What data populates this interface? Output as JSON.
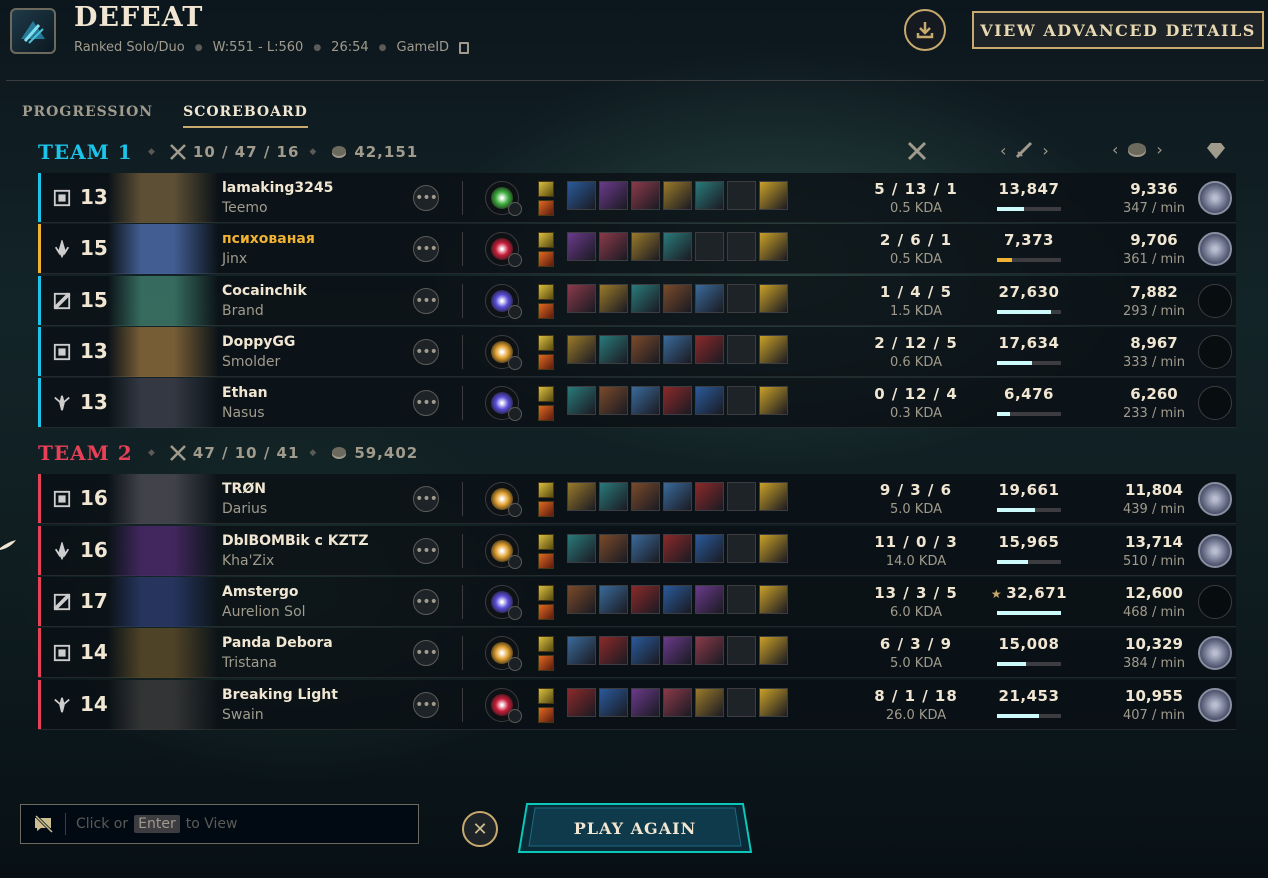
{
  "header": {
    "title": "DEFEAT",
    "queue": "Ranked Solo/Duo",
    "record": "W:551 - L:560",
    "duration": "26:54",
    "game_id_label": "GameID",
    "advanced_button": "VIEW ADVANCED DETAILS",
    "download_icon": "download-icon"
  },
  "tabs": [
    {
      "label": "PROGRESSION",
      "active": false
    },
    {
      "label": "SCOREBOARD",
      "active": true
    }
  ],
  "columns": {
    "kda_icon": "crossed-swords-icon",
    "damage_icon": "sword-icon",
    "gold_icon": "gold-coins-icon",
    "rank_icon": "diamond-icon"
  },
  "teams": [
    {
      "name": "TEAM 1",
      "color": "#1bc4e8",
      "kda": "10 / 47 / 16",
      "gold": "42,151",
      "players": [
        {
          "level": "13",
          "role": "top",
          "name": "lamaking3245",
          "champion": "Teemo",
          "kda": "5 / 13 / 1",
          "kda_ratio": "0.5 KDA",
          "damage": "13,847",
          "damage_fraction": 0.42,
          "gold": "9,336",
          "gold_per_min": "347 / min",
          "portrait_color": "#6b5a3a",
          "keystone_color": "#3fae3f",
          "emblem": true,
          "self": false
        },
        {
          "level": "15",
          "role": "bottom",
          "name": "психованая",
          "champion": "Jinx",
          "kda": "2 / 6 / 1",
          "kda_ratio": "0.5 KDA",
          "damage": "7,373",
          "damage_fraction": 0.23,
          "gold": "9,706",
          "gold_per_min": "361 / min",
          "portrait_color": "#4b6aa8",
          "keystone_color": "#c9203c",
          "emblem": true,
          "self": true
        },
        {
          "level": "15",
          "role": "support",
          "name": "Cocainchik",
          "champion": "Brand",
          "kda": "1 / 4 / 5",
          "kda_ratio": "1.5 KDA",
          "damage": "27,630",
          "damage_fraction": 0.85,
          "gold": "7,882",
          "gold_per_min": "293 / min",
          "portrait_color": "#3d7a6a",
          "keystone_color": "#5b4fd8",
          "emblem": false,
          "self": false
        },
        {
          "level": "13",
          "role": "top",
          "name": "DoppyGG",
          "champion": "Smolder",
          "kda": "2 / 12 / 5",
          "kda_ratio": "0.6 KDA",
          "damage": "17,634",
          "damage_fraction": 0.54,
          "gold": "8,967",
          "gold_per_min": "333 / min",
          "portrait_color": "#8a6a3a",
          "keystone_color": "#e0a030",
          "emblem": false,
          "self": false
        },
        {
          "level": "13",
          "role": "jungle",
          "name": "Ethan",
          "champion": "Nasus",
          "kda": "0 / 12 / 4",
          "kda_ratio": "0.3 KDA",
          "damage": "6,476",
          "damage_fraction": 0.2,
          "gold": "6,260",
          "gold_per_min": "233 / min",
          "portrait_color": "#3a3f4a",
          "keystone_color": "#5b4fd8",
          "emblem": false,
          "self": false
        }
      ]
    },
    {
      "name": "TEAM 2",
      "color": "#e84057",
      "kda": "47 / 10 / 41",
      "gold": "59,402",
      "players": [
        {
          "level": "16",
          "role": "top",
          "name": "TRØN",
          "champion": "Darius",
          "kda": "9 / 3 / 6",
          "kda_ratio": "5.0 KDA",
          "damage": "19,661",
          "damage_fraction": 0.6,
          "gold": "11,804",
          "gold_per_min": "439 / min",
          "portrait_color": "#4a4a52",
          "keystone_color": "#e0a030",
          "emblem": true,
          "self": false
        },
        {
          "level": "16",
          "role": "bottom",
          "name": "DblBOMBik с KZTZ",
          "champion": "Kha'Zix",
          "kda": "11 / 0 / 3",
          "kda_ratio": "14.0 KDA",
          "damage": "15,965",
          "damage_fraction": 0.49,
          "gold": "13,714",
          "gold_per_min": "510 / min",
          "portrait_color": "#4a2a6a",
          "keystone_color": "#e0a030",
          "emblem": true,
          "self": false
        },
        {
          "level": "17",
          "role": "support",
          "name": "Amstergo",
          "champion": "Aurelion Sol",
          "kda": "13 / 3 / 5",
          "kda_ratio": "6.0 KDA",
          "damage": "32,671",
          "damage_fraction": 1.0,
          "damage_star": "★",
          "gold": "12,600",
          "gold_per_min": "468 / min",
          "portrait_color": "#2a3a6a",
          "keystone_color": "#5b4fd8",
          "emblem": false,
          "self": false
        },
        {
          "level": "14",
          "role": "top",
          "name": "Panda Debora",
          "champion": "Tristana",
          "kda": "6 / 3 / 9",
          "kda_ratio": "5.0 KDA",
          "damage": "15,008",
          "damage_fraction": 0.46,
          "gold": "10,329",
          "gold_per_min": "384 / min",
          "portrait_color": "#5a4a2a",
          "keystone_color": "#e0a030",
          "emblem": true,
          "self": false
        },
        {
          "level": "14",
          "role": "jungle",
          "name": "Breaking Light",
          "champion": "Swain",
          "kda": "8 / 1 / 18",
          "kda_ratio": "26.0 KDA",
          "damage": "21,453",
          "damage_fraction": 0.66,
          "gold": "10,955",
          "gold_per_min": "407 / min",
          "portrait_color": "#3a3a3a",
          "keystone_color": "#c9203c",
          "emblem": true,
          "self": false
        }
      ]
    }
  ],
  "chat": {
    "prefix": "Click or",
    "key": "Enter",
    "suffix": "to View",
    "icon": "chat-muted-icon"
  },
  "footer": {
    "play_again": "PLAY AGAIN",
    "close_icon": "close-icon"
  }
}
